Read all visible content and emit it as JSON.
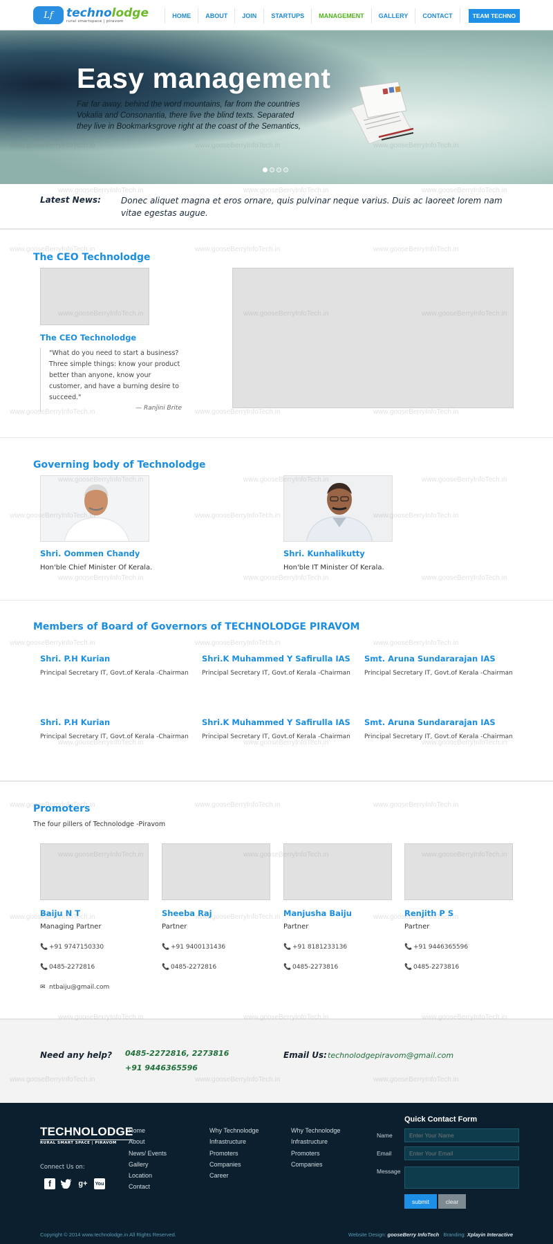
{
  "brand": {
    "logo_mark": "Lf",
    "name_part1": "techno",
    "name_part2": "lodge",
    "tagline": "rural smartspace  |  piravom"
  },
  "nav": {
    "items": [
      "HOME",
      "ABOUT",
      "JOIN",
      "STARTUPS",
      "MANAGEMENT",
      "GALLERY",
      "CONTACT"
    ],
    "active": "MANAGEMENT",
    "cta": "TEAM TECHNO"
  },
  "hero": {
    "title": "Easy management",
    "text": "Far far away, behind the word mountains, far from the countries Vokalia and Consonantia, there live the blind texts. Separated they live in Bookmarksgrove right at the coast of the Semantics,",
    "slides": 4,
    "active_slide": 1
  },
  "news": {
    "label": "Latest News:",
    "text": "Donec aliquet magna et eros ornare, quis pulvinar neque varius. Duis ac laoreet lorem nam vitae egestas augue."
  },
  "ceo": {
    "section_title": "The CEO Technolodge",
    "card_title": "The CEO Technolodge",
    "quote": "\"What do you need to start a business? Three simple things: know your product better than anyone, know your customer, and have a burning desire to succeed.\"",
    "author": "— Ranjini Brite"
  },
  "governing": {
    "title": "Governing body of Technolodge",
    "people": [
      {
        "name": "Shri. Oommen Chandy",
        "role": "Hon'ble Chief Minister Of Kerala."
      },
      {
        "name": "Shri. Kunhalikutty",
        "role": "Hon'ble IT Minister Of Kerala."
      }
    ]
  },
  "board": {
    "title": "Members of Board of Governors of TECHNOLODGE PIRAVOM",
    "rows": [
      [
        {
          "name": "Shri. P.H Kurian",
          "role": "Principal Secretary IT, Govt.of Kerala -Chairman"
        },
        {
          "name": "Shri.K Muhammed Y Safirulla IAS",
          "role": "Principal Secretary IT, Govt.of Kerala -Chairman"
        },
        {
          "name": "Smt. Aruna Sundararajan IAS",
          "role": "Principal Secretary IT, Govt.of Kerala -Chairman"
        }
      ],
      [
        {
          "name": "Shri. P.H Kurian",
          "role": "Principal Secretary IT, Govt.of Kerala -Chairman"
        },
        {
          "name": "Shri.K Muhammed Y Safirulla IAS",
          "role": "Principal Secretary IT, Govt.of Kerala -Chairman"
        },
        {
          "name": "Smt. Aruna Sundararajan IAS",
          "role": "Principal Secretary IT, Govt.of Kerala -Chairman"
        }
      ]
    ]
  },
  "promoters": {
    "title": "Promoters",
    "subtitle": "The four pillers of Technolodge -Piravom",
    "people": [
      {
        "name": "Baiju N T",
        "role": "Managing Partner",
        "mobile": "+91 9747150330",
        "phone": "0485-2272816",
        "email": "ntbaiju@gmail.com"
      },
      {
        "name": "Sheeba Raj",
        "role": "Partner",
        "mobile": "+91 9400131436",
        "phone": "0485-2272816"
      },
      {
        "name": "Manjusha Baiju",
        "role": "Partner",
        "mobile": "+91 8181233136",
        "phone": "0485-2273816"
      },
      {
        "name": "Renjith P S",
        "role": "Partner",
        "mobile": "+91 9446365596",
        "phone": "0485-2273816"
      }
    ]
  },
  "help": {
    "label": "Need any help?",
    "phones": "0485-2272816, 2273816",
    "mobile": "+91 9446365596",
    "email_label": "Email Us:",
    "email": "technolodgepiravom@gmail.com"
  },
  "footer": {
    "logo_name": "TECHNOLODGE",
    "logo_tag": "RURAL SMART SPACE  |  PIRAVOM",
    "connect": "Connect Us on:",
    "social_icons": [
      "facebook-icon",
      "twitter-icon",
      "google-plus-icon",
      "youtube-icon"
    ],
    "col1": [
      "Home",
      "About",
      "News/ Events",
      "Gallery",
      "Location",
      "Contact"
    ],
    "col2": [
      "Why Technolodge",
      "Infrastructure",
      "Promoters",
      "Companies",
      "Career"
    ],
    "col3": [
      "Why Technolodge",
      "Infrastructure",
      "Promoters",
      "Companies"
    ],
    "form": {
      "title": "Quick Contact Form",
      "name_label": "Name",
      "name_placeholder": "Enter Your Name",
      "email_label": "Email",
      "email_placeholder": "Enter Your Email",
      "message_label": "Message",
      "submit": "submit",
      "clear": "clear"
    },
    "copyright": "Copyright  © 2014   www.technolodge.in   All Rights Reserved.",
    "design_label": "Website Design:",
    "design_by": "gooseBerry InfoTech",
    "branding_label": "Branding:",
    "branding_by": "Xplayin Interactive"
  },
  "watermark": "www.gooseBerryInfoTech.in",
  "colors": {
    "accent": "#1b8ee0",
    "active_nav": "#4fb31a",
    "footer_bg": "#0b1f2e",
    "help_text": "#1f6f3a"
  }
}
